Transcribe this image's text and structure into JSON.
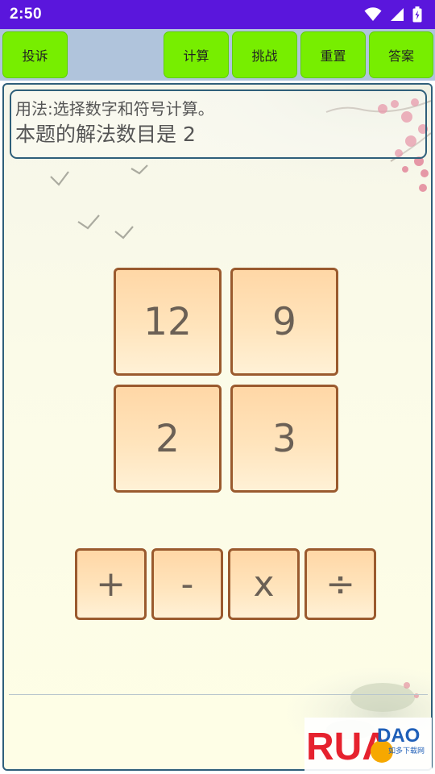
{
  "status_bar": {
    "time": "2:50",
    "icons": [
      "wifi-icon",
      "signal-icon",
      "battery-icon"
    ]
  },
  "toolbar": {
    "complain": "投诉",
    "calculate": "计算",
    "challenge": "挑战",
    "reset": "重置",
    "answer": "答案"
  },
  "info": {
    "usage": "用法:选择数字和符号计算。",
    "solutions": "本题的解法数目是 2"
  },
  "numbers": [
    "12",
    "9",
    "2",
    "3"
  ],
  "operators": [
    "+",
    "-",
    "x",
    "÷"
  ],
  "watermark": {
    "brand": "RUANDAO",
    "sub": "如多下载网"
  },
  "colors": {
    "status_bar": "#5a16dc",
    "toolbar_bg": "#b0c4dc",
    "button_green": "#77ee00",
    "tile_border": "#9a5a2e",
    "tile_fill": "#ffe4bc",
    "frame_border": "#2f5f7a"
  }
}
